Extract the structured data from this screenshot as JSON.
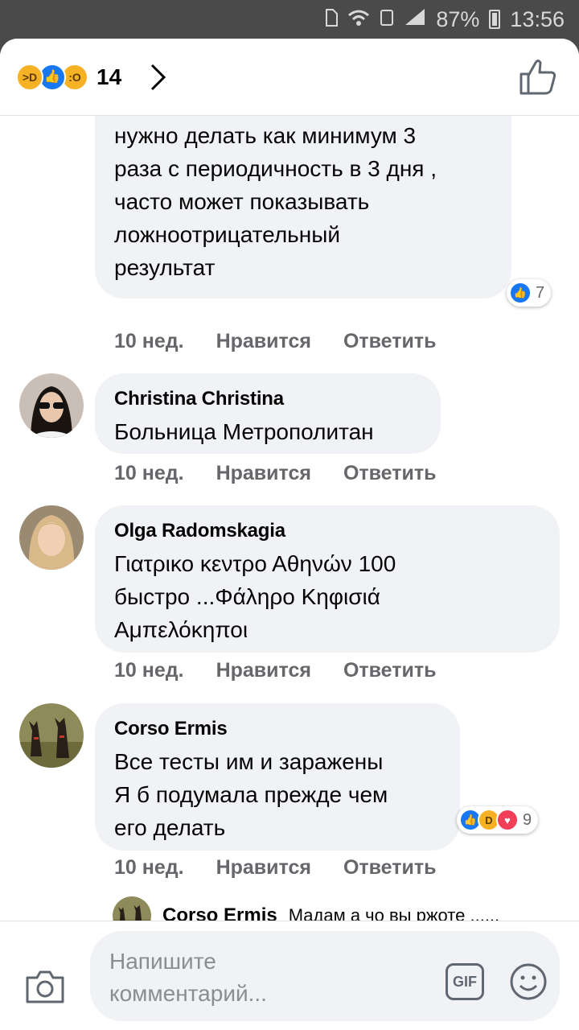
{
  "status_bar": {
    "battery": "87%",
    "time": "13:56"
  },
  "header": {
    "reactions": [
      "haha",
      "like",
      "wow"
    ],
    "reaction_count": "14",
    "icons": {
      "chevron": "chevron-right-icon",
      "like": "thumbs-up-outline-icon"
    }
  },
  "comments": [
    {
      "name": "",
      "text": "нужно делать как минимум 3\nраза с периодичность в 3 дня ,\nчасто может показывать\nложноотрицательный\nрезультат",
      "reactions": [
        "like"
      ],
      "reaction_count": "7",
      "time": "10 нед.",
      "like_label": "Нравится",
      "reply_label": "Ответить"
    },
    {
      "name": "Christina Christina",
      "text": "Больница Метрополитан",
      "time": "10 нед.",
      "like_label": "Нравится",
      "reply_label": "Ответить"
    },
    {
      "name": "Olga Radomskagia",
      "text": "Γιατρικο κεντρο Αθηνών     100\nбыстро ...Φάληρο Κηφισιά\nΑμπελόκηποι",
      "time": "10 нед.",
      "like_label": "Нравится",
      "reply_label": "Ответить"
    },
    {
      "name": "Corso Ermis",
      "text": "Все тесты им и заражены\nЯ б подумала прежде чем\nего делать",
      "reactions": [
        "like",
        "haha",
        "love"
      ],
      "reaction_count": "9",
      "time": "10 нед.",
      "like_label": "Нравится",
      "reply_label": "Ответить"
    }
  ],
  "reply_preview": {
    "name": "Corso Ermis",
    "text": "Мадам а чо вы ржоте ......"
  },
  "composer": {
    "placeholder": "Напишите\nкомментарий...",
    "gif_label": "GIF"
  },
  "colors": {
    "accent": "#1877f2",
    "bubble": "#f0f2f5",
    "meta": "#65676b"
  }
}
